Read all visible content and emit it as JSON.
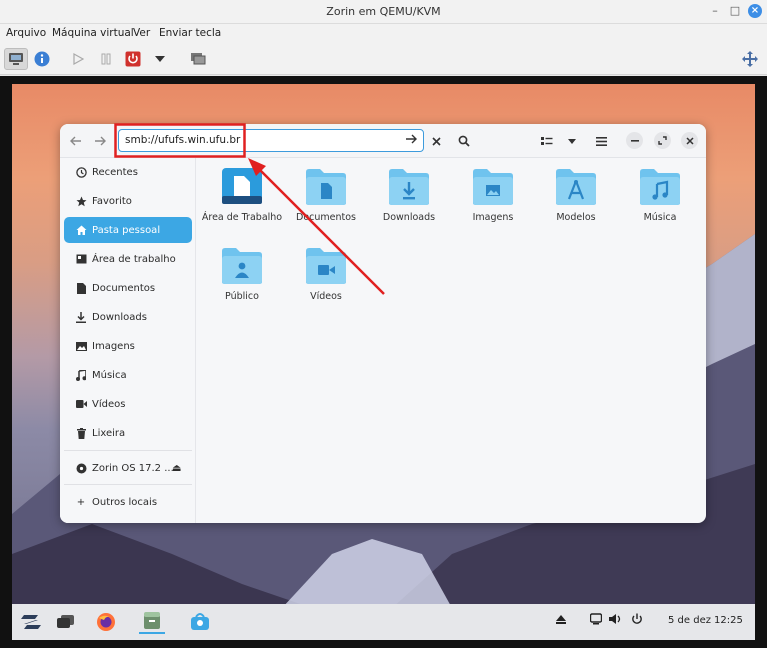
{
  "window": {
    "title": "Zorin em QEMU/KVM",
    "minimize": "–",
    "maximize": "□",
    "close": "×"
  },
  "menubar": {
    "items": [
      "Arquivo",
      "Máquina virtual",
      "Ver",
      "Enviar tecla"
    ]
  },
  "toolbar": {
    "icons": [
      "monitor-icon",
      "info-icon",
      "play-icon",
      "pause-icon",
      "power-icon",
      "dropdown-icon",
      "snapshot-icon",
      "fullscreen-icon"
    ]
  },
  "file_manager": {
    "path": "smb://ufufs.win.ufu.br",
    "sidebar": [
      {
        "label": "Recentes",
        "icon": "clock-icon"
      },
      {
        "label": "Favorito",
        "icon": "star-icon"
      },
      {
        "label": "Pasta pessoal",
        "icon": "home-icon",
        "active": true
      },
      {
        "label": "Área de trabalho",
        "icon": "desktop-icon"
      },
      {
        "label": "Documentos",
        "icon": "document-icon"
      },
      {
        "label": "Downloads",
        "icon": "download-icon"
      },
      {
        "label": "Imagens",
        "icon": "image-icon"
      },
      {
        "label": "Música",
        "icon": "music-icon"
      },
      {
        "label": "Vídeos",
        "icon": "video-icon"
      },
      {
        "label": "Lixeira",
        "icon": "trash-icon"
      }
    ],
    "drive": {
      "label": "Zorin OS 17.2 ...",
      "eject": "⏏"
    },
    "other": {
      "label": "Outros locais",
      "icon": "+"
    },
    "folders": [
      {
        "label": "Área de Trabalho",
        "icon": "desktop-folder-icon"
      },
      {
        "label": "Documentos",
        "icon": "document-folder-icon"
      },
      {
        "label": "Downloads",
        "icon": "download-folder-icon"
      },
      {
        "label": "Imagens",
        "icon": "image-folder-icon"
      },
      {
        "label": "Modelos",
        "icon": "template-folder-icon"
      },
      {
        "label": "Música",
        "icon": "music-folder-icon"
      },
      {
        "label": "Público",
        "icon": "public-folder-icon"
      },
      {
        "label": "Vídeos",
        "icon": "video-folder-icon"
      }
    ]
  },
  "taskbar": {
    "date": "5 de dez",
    "time": "12:25"
  },
  "colors": {
    "accent": "#3ca7e4",
    "folder": "#6fc3ee",
    "annotation": "#e02020"
  }
}
